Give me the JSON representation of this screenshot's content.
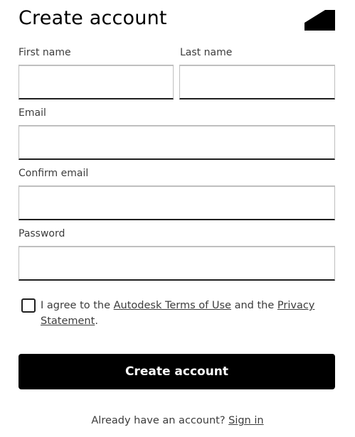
{
  "header": {
    "title": "Create account",
    "logo_icon": "autodesk-logo-icon"
  },
  "form": {
    "first_name_label": "First name",
    "first_name_value": "",
    "last_name_label": "Last name",
    "last_name_value": "",
    "email_label": "Email",
    "email_value": "",
    "confirm_email_label": "Confirm email",
    "confirm_email_value": "",
    "password_label": "Password",
    "password_value": ""
  },
  "agreement": {
    "checked": false,
    "text_prefix": "I agree to the ",
    "terms_link": "Autodesk Terms of Use",
    "text_middle": " and the ",
    "privacy_link": "Privacy Statement",
    "text_suffix": "."
  },
  "actions": {
    "submit_label": "Create account",
    "signin_prompt": "Already have an account? ",
    "signin_link": "Sign in"
  },
  "colors": {
    "primary_button": "#000000",
    "text": "#3c3c3c",
    "field_border": "#bfbfbf",
    "field_bottom_border": "#1f1f1f"
  }
}
